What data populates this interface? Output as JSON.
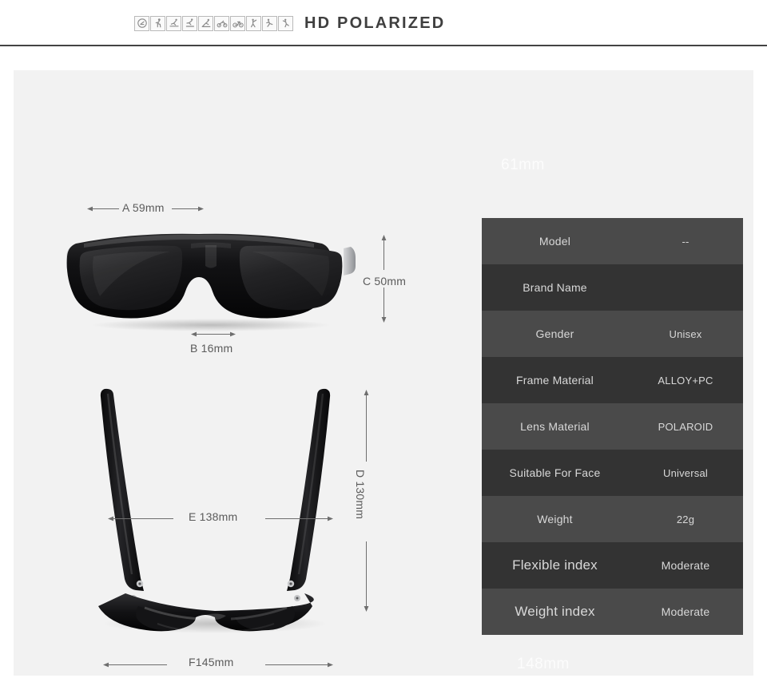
{
  "header": {
    "title": "HD POLARIZED",
    "icons": [
      "golf-icon",
      "running-icon",
      "skiing-icon",
      "skateboarding-icon",
      "climbing-icon",
      "motorcycling-icon",
      "cycling-icon",
      "fishing-icon",
      "soccer-icon",
      "tennis-icon"
    ]
  },
  "watermarks": {
    "top": "61mm",
    "bottom": "148mm"
  },
  "dimensions": {
    "a": "A 59mm",
    "b": "B 16mm",
    "c": "C 50mm",
    "d": "D 130mm",
    "e": "E 138mm",
    "f": "F145mm"
  },
  "spec_table": {
    "rows": [
      {
        "key": "Model",
        "value": "--"
      },
      {
        "key": "Brand Name",
        "value": ""
      },
      {
        "key": "Gender",
        "value": "Unisex"
      },
      {
        "key": "Frame Material",
        "value": "ALLOY+PC"
      },
      {
        "key": "Lens Material",
        "value": "POLAROID"
      },
      {
        "key": "Suitable For Face",
        "value": "Universal"
      },
      {
        "key": "Weight",
        "value": "22g"
      },
      {
        "key": "Flexible index",
        "value": "Moderate"
      },
      {
        "key": "Weight index",
        "value": "Moderate"
      }
    ]
  },
  "colors": {
    "page_background": "#ffffff",
    "panel_background": "#f2f2f2",
    "rule": "#434343",
    "table_row_light": "#4a4a4a",
    "table_row_dark": "#333333",
    "table_text": "#d8d8d8",
    "dimension_text": "#5b5b5b",
    "title_text": "#3f3f3f"
  }
}
